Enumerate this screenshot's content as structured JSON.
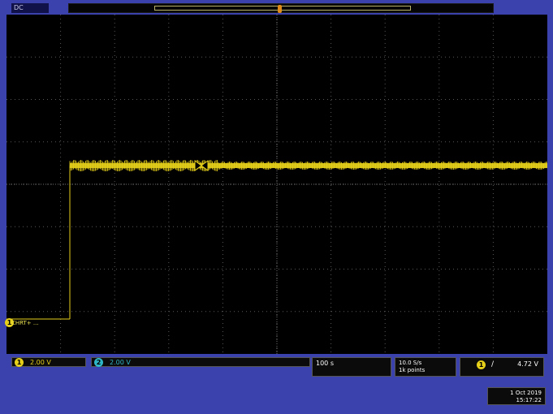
{
  "topbar": {
    "run_label": "DC"
  },
  "colors": {
    "ch1": "#e6d01a",
    "ch2": "#2fb6c6",
    "grid": "#6e6e6e",
    "bezel": "#3b41ad",
    "screen": "#000000"
  },
  "ground_marker": {
    "channel": "1",
    "label": "CHRT+ ..."
  },
  "channels": [
    {
      "badge": "1",
      "scale": "2.00 V"
    },
    {
      "badge": "2",
      "scale": "2.00 V"
    }
  ],
  "timebase": {
    "value": "100 s"
  },
  "acquisition": {
    "rate": "10.0 S/s",
    "length": "1k points"
  },
  "trigger": {
    "channel": "1",
    "slope": "/",
    "level": "4.72 V"
  },
  "clock": {
    "date": "1 Oct 2019",
    "time": "15:17:22"
  },
  "icons": {
    "trigger_position": "trigger-position-icon",
    "ground_marker": "channel-ground-marker-icon"
  }
}
